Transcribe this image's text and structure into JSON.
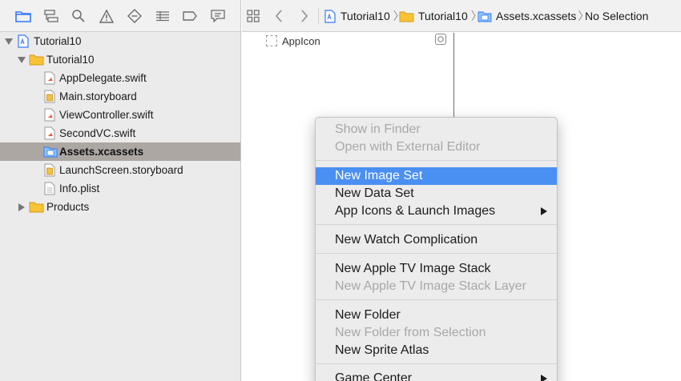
{
  "navigator": {
    "toolbar_icons": [
      "folder-icon",
      "hierarchy-icon",
      "search-icon",
      "warning-icon",
      "diamond-icon",
      "test-icon",
      "breakpoint-icon",
      "report-icon"
    ],
    "accent_color": "#3478f6",
    "tree": [
      {
        "label": "Tutorial10",
        "icon": "project-icon",
        "expanded": true
      },
      {
        "label": "Tutorial10",
        "icon": "folder-icon",
        "expanded": true
      },
      {
        "label": "AppDelegate.swift",
        "icon": "swift-file-icon"
      },
      {
        "label": "Main.storyboard",
        "icon": "storyboard-file-icon"
      },
      {
        "label": "ViewController.swift",
        "icon": "swift-file-icon"
      },
      {
        "label": "SecondVC.swift",
        "icon": "swift-file-icon"
      },
      {
        "label": "Assets.xcassets",
        "icon": "asset-catalog-icon",
        "selected": true
      },
      {
        "label": "LaunchScreen.storyboard",
        "icon": "storyboard-file-icon"
      },
      {
        "label": "Info.plist",
        "icon": "plist-file-icon"
      },
      {
        "label": "Products",
        "icon": "folder-icon",
        "expanded": false
      }
    ]
  },
  "jumpbar": {
    "crumbs": [
      "Tutorial10",
      "Tutorial10",
      "Assets.xcassets",
      "No Selection"
    ]
  },
  "editor": {
    "asset_item": "AppIcon"
  },
  "context_menu": {
    "items": [
      {
        "label": "Show in Finder",
        "enabled": false
      },
      {
        "label": "Open with External Editor",
        "enabled": false
      },
      {
        "label": "New Image Set",
        "enabled": true,
        "highlighted": true
      },
      {
        "label": "New Data Set",
        "enabled": true
      },
      {
        "label": "App Icons & Launch Images",
        "enabled": true,
        "submenu": true
      },
      {
        "label": "New Watch Complication",
        "enabled": true
      },
      {
        "label": "New Apple TV Image Stack",
        "enabled": true
      },
      {
        "label": "New Apple TV Image Stack Layer",
        "enabled": false
      },
      {
        "label": "New Folder",
        "enabled": true
      },
      {
        "label": "New Folder from Selection",
        "enabled": false
      },
      {
        "label": "New Sprite Atlas",
        "enabled": true
      },
      {
        "label": "Game Center",
        "enabled": true,
        "submenu": true
      }
    ],
    "highlight_color": "#4a8ff2"
  }
}
